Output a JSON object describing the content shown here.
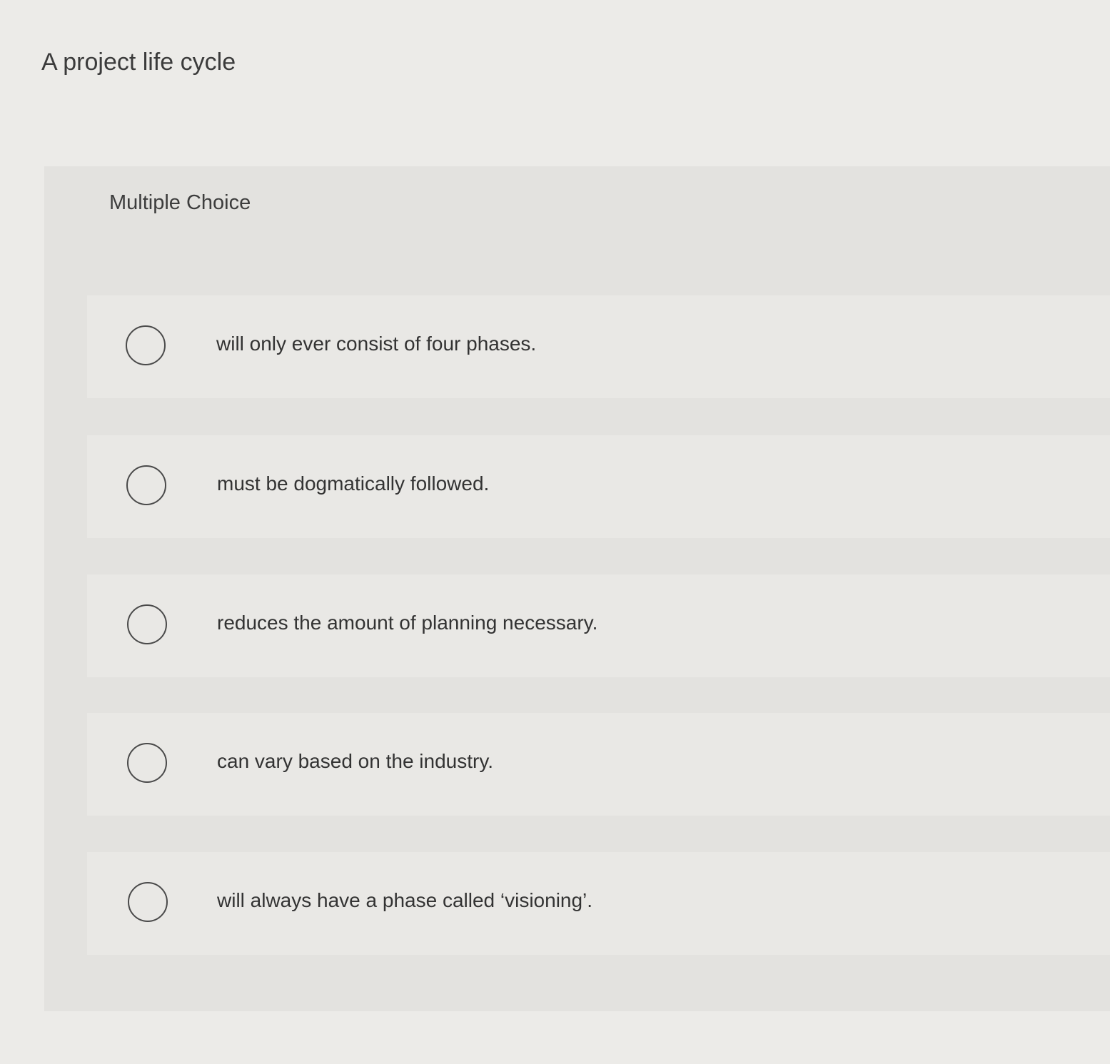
{
  "question": {
    "prompt": "A project life cycle"
  },
  "panel": {
    "label": "Multiple Choice"
  },
  "options": [
    {
      "text": "will only ever consist of four phases.",
      "selected": false
    },
    {
      "text": "must be dogmatically followed.",
      "selected": false
    },
    {
      "text": "reduces the amount of planning necessary.",
      "selected": false
    },
    {
      "text": "can vary based on the industry.",
      "selected": false
    },
    {
      "text": "will always have a phase called ‘visioning’.",
      "selected": false
    }
  ]
}
